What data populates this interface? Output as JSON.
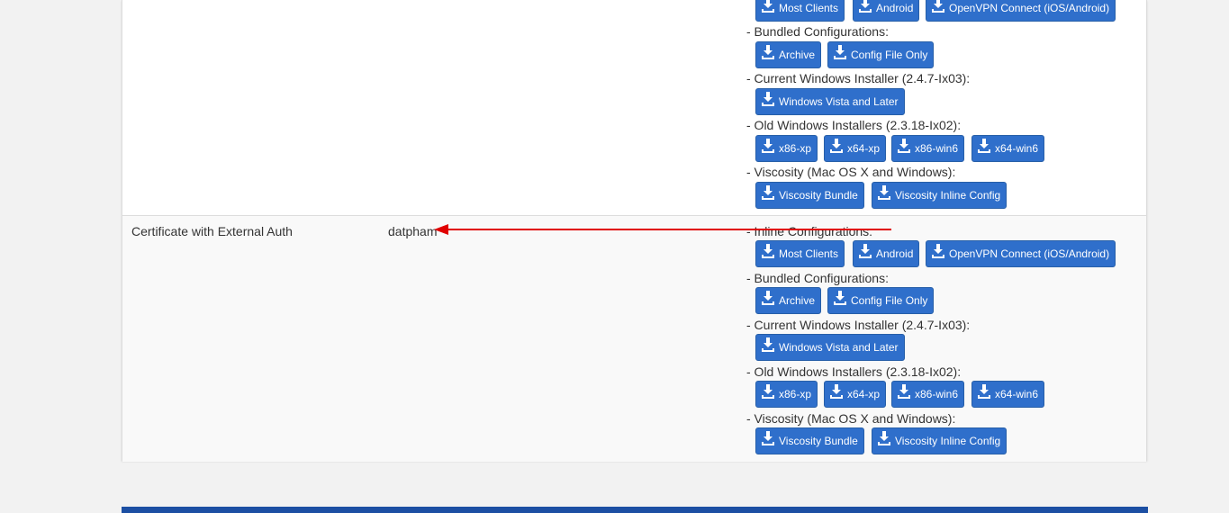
{
  "rows": [
    {
      "auth_mode": "",
      "user": "",
      "groups": [
        {
          "label": "",
          "buttons": [
            "Most Clients",
            "Android",
            "OpenVPN Connect (iOS/Android)"
          ]
        },
        {
          "label": "- Bundled Configurations:",
          "buttons": [
            "Archive",
            "Config File Only"
          ]
        },
        {
          "label": "- Current Windows Installer (2.4.7-Ix03):",
          "buttons": [
            "Windows Vista and Later"
          ]
        },
        {
          "label": "- Old Windows Installers (2.3.18-Ix02):",
          "buttons": [
            "x86-xp",
            "x64-xp",
            "x86-win6",
            "x64-win6"
          ]
        },
        {
          "label": "- Viscosity (Mac OS X and Windows):",
          "buttons": [
            "Viscosity Bundle",
            "Viscosity Inline Config"
          ]
        }
      ]
    },
    {
      "auth_mode": "Certificate with External Auth",
      "user": "datpham",
      "groups": [
        {
          "label": "- Inline Configurations:",
          "buttons": [
            "Most Clients",
            "Android",
            "OpenVPN Connect (iOS/Android)"
          ]
        },
        {
          "label": "- Bundled Configurations:",
          "buttons": [
            "Archive",
            "Config File Only"
          ]
        },
        {
          "label": "- Current Windows Installer (2.4.7-Ix03):",
          "buttons": [
            "Windows Vista and Later"
          ]
        },
        {
          "label": "- Old Windows Installers (2.3.18-Ix02):",
          "buttons": [
            "x86-xp",
            "x64-xp",
            "x86-win6",
            "x64-win6"
          ]
        },
        {
          "label": "- Viscosity (Mac OS X and Windows):",
          "buttons": [
            "Viscosity Bundle",
            "Viscosity Inline Config"
          ]
        }
      ]
    }
  ],
  "icons": {
    "download": "download-icon"
  },
  "colors": {
    "button": "#2f6fcb",
    "annotation_arrow": "#e00000",
    "footer_bar": "#1c4fa3"
  }
}
